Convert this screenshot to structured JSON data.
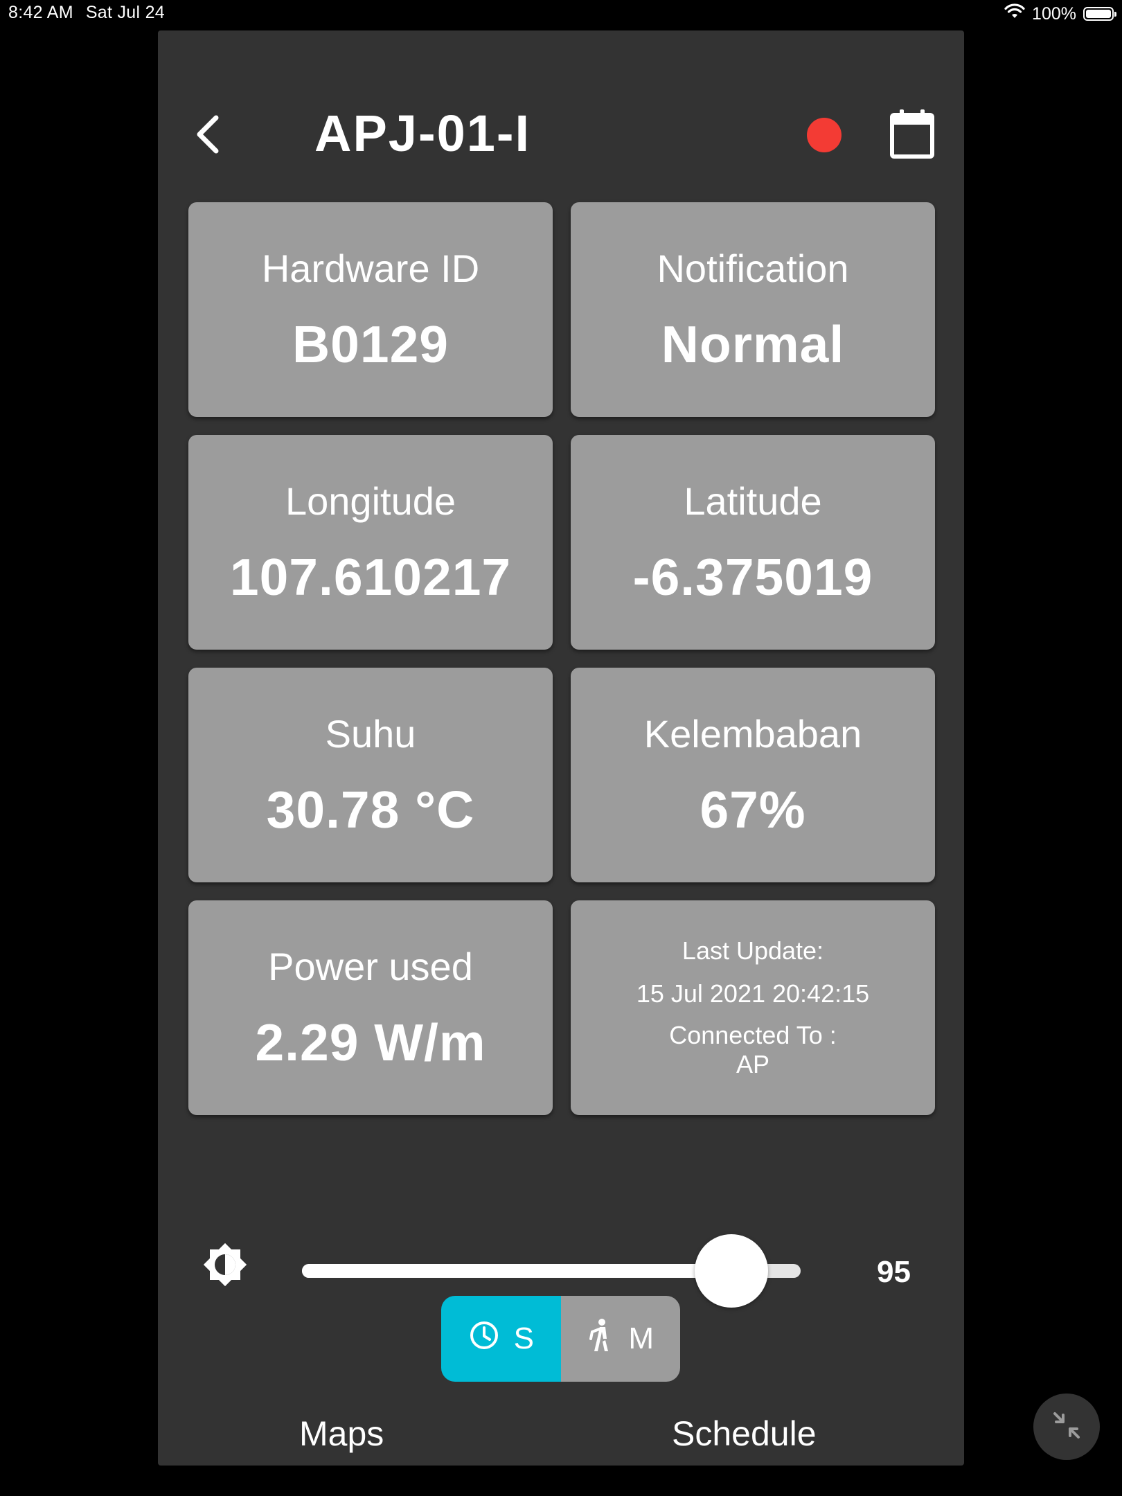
{
  "status_bar": {
    "time": "8:42 AM",
    "date": "Sat Jul 24",
    "battery": "100%"
  },
  "header": {
    "title": "APJ-01-I",
    "status_color": "#f33b34"
  },
  "cards": {
    "hardware_id": {
      "label": "Hardware ID",
      "value": "B0129"
    },
    "notification": {
      "label": "Notification",
      "value": "Normal"
    },
    "longitude": {
      "label": "Longitude",
      "value": "107.610217"
    },
    "latitude": {
      "label": "Latitude",
      "value": "-6.375019"
    },
    "suhu": {
      "label": "Suhu",
      "value": "30.78 °C"
    },
    "kelembaban": {
      "label": "Kelembaban",
      "value": "67%"
    },
    "power": {
      "label": "Power used",
      "value": "2.29 W/m"
    },
    "info": {
      "last_update_label": "Last Update:",
      "last_update_value": "15 Jul 2021 20:42:15",
      "connected_label": "Connected To :",
      "connected_value": "AP"
    }
  },
  "brightness": {
    "value": "95",
    "fraction": 0.95
  },
  "mode_toggle": {
    "schedule_short": "S",
    "manual_short": "M",
    "active": "S",
    "active_color": "#00bcd6"
  },
  "bottom_labels": {
    "maps": "Maps",
    "schedule": "Schedule"
  },
  "icons": {
    "back": "chevron-left-icon",
    "calendar": "calendar-icon",
    "brightness": "brightness-icon",
    "clock": "clock-icon",
    "person": "person-walking-icon",
    "minimize": "minimize-arrows-icon",
    "wifi": "wifi-icon",
    "battery": "battery-icon"
  }
}
